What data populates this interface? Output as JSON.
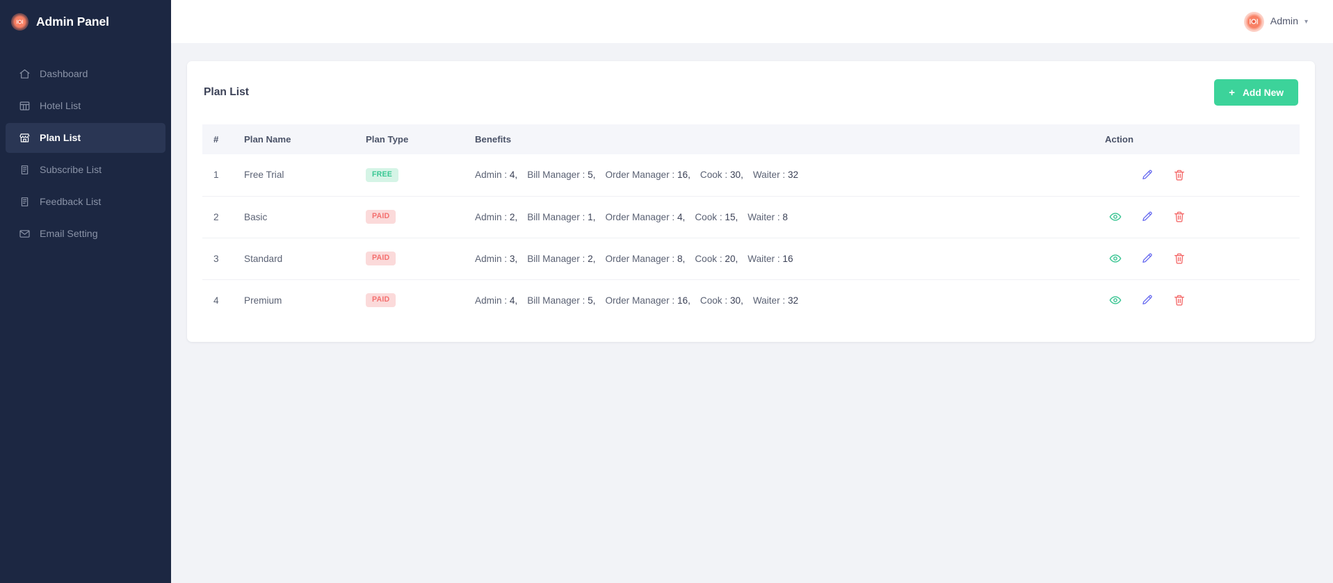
{
  "brand": {
    "title": "Admin Panel",
    "logo_icon": "restaurant-plate-icon",
    "accent": "#f87f63"
  },
  "sidebar": {
    "bg": "#1c2742",
    "active_bg": "#2a3654",
    "items": [
      {
        "label": "Dashboard",
        "icon": "home-icon",
        "active": false
      },
      {
        "label": "Hotel List",
        "icon": "table-grid-icon",
        "active": false
      },
      {
        "label": "Plan List",
        "icon": "store-icon",
        "active": true
      },
      {
        "label": "Subscribe List",
        "icon": "clipboard-list-icon",
        "active": false
      },
      {
        "label": "Feedback List",
        "icon": "clipboard-list-icon",
        "active": false
      },
      {
        "label": "Email Setting",
        "icon": "envelope-icon",
        "active": false
      }
    ]
  },
  "topbar": {
    "user_name": "Admin",
    "avatar_icon": "restaurant-plate-icon",
    "caret_icon": "chevron-down-icon"
  },
  "card": {
    "title": "Plan List",
    "add_button": {
      "label": "Add New",
      "icon": "plus-icon",
      "color": "#3cd39a"
    }
  },
  "table": {
    "columns": [
      "#",
      "Plan Name",
      "Plan Type",
      "Benefits",
      "Action"
    ],
    "rows": [
      {
        "num": "1",
        "plan_name": "Free Trial",
        "plan_type": "FREE",
        "plan_type_variant": "free",
        "benefits": [
          {
            "label": "Admin :",
            "value": "4,"
          },
          {
            "label": "Bill Manager :",
            "value": "5,"
          },
          {
            "label": "Order Manager :",
            "value": "16,"
          },
          {
            "label": "Cook :",
            "value": "30,"
          },
          {
            "label": "Waiter :",
            "value": "32"
          }
        ],
        "actions": [
          "edit",
          "delete"
        ]
      },
      {
        "num": "2",
        "plan_name": "Basic",
        "plan_type": "PAID",
        "plan_type_variant": "paid",
        "benefits": [
          {
            "label": "Admin :",
            "value": "2,"
          },
          {
            "label": "Bill Manager :",
            "value": "1,"
          },
          {
            "label": "Order Manager :",
            "value": "4,"
          },
          {
            "label": "Cook :",
            "value": "15,"
          },
          {
            "label": "Waiter :",
            "value": "8"
          }
        ],
        "actions": [
          "view",
          "edit",
          "delete"
        ]
      },
      {
        "num": "3",
        "plan_name": "Standard",
        "plan_type": "PAID",
        "plan_type_variant": "paid",
        "benefits": [
          {
            "label": "Admin :",
            "value": "3,"
          },
          {
            "label": "Bill Manager :",
            "value": "2,"
          },
          {
            "label": "Order Manager :",
            "value": "8,"
          },
          {
            "label": "Cook :",
            "value": "20,"
          },
          {
            "label": "Waiter :",
            "value": "16"
          }
        ],
        "actions": [
          "view",
          "edit",
          "delete"
        ]
      },
      {
        "num": "4",
        "plan_name": "Premium",
        "plan_type": "PAID",
        "plan_type_variant": "paid",
        "benefits": [
          {
            "label": "Admin :",
            "value": "4,"
          },
          {
            "label": "Bill Manager :",
            "value": "5,"
          },
          {
            "label": "Order Manager :",
            "value": "16,"
          },
          {
            "label": "Cook :",
            "value": "30,"
          },
          {
            "label": "Waiter :",
            "value": "32"
          }
        ],
        "actions": [
          "view",
          "edit",
          "delete"
        ]
      }
    ],
    "action_colors": {
      "view": "#34c38f",
      "edit": "#6a6df0",
      "delete": "#f46a6a"
    }
  }
}
